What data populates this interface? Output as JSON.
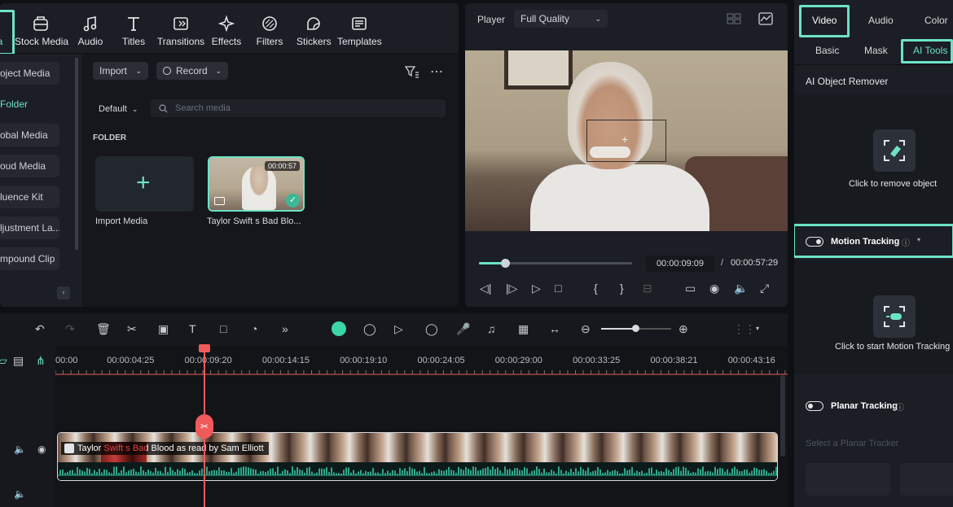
{
  "toolbar": {
    "tabs": [
      {
        "label": "a",
        "icon": "media-icon"
      },
      {
        "label": "Stock Media",
        "icon": "stock-media-icon"
      },
      {
        "label": "Audio",
        "icon": "music-note-icon"
      },
      {
        "label": "Titles",
        "icon": "text-t-icon"
      },
      {
        "label": "Transitions",
        "icon": "transition-icon"
      },
      {
        "label": "Effects",
        "icon": "sparkle-icon"
      },
      {
        "label": "Filters",
        "icon": "filter-icon"
      },
      {
        "label": "Stickers",
        "icon": "sticker-icon"
      },
      {
        "label": "Templates",
        "icon": "templates-icon"
      }
    ]
  },
  "sidebar": {
    "items": [
      {
        "label": "oject Media"
      },
      {
        "label": "Folder"
      },
      {
        "label": "obal Media"
      },
      {
        "label": "oud Media"
      },
      {
        "label": "luence Kit"
      },
      {
        "label": "ljustment La..."
      },
      {
        "label": "mpound Clip"
      }
    ]
  },
  "media": {
    "import_label": "Import",
    "record_label": "Record",
    "default_label": "Default",
    "search_placeholder": "Search media",
    "folder_heading": "FOLDER",
    "import_card_label": "Import Media",
    "clip_label": "Taylor Swift s  Bad Blo...",
    "clip_duration": "00:00:57"
  },
  "player": {
    "label": "Player",
    "quality": "Full Quality",
    "current_time": "00:00:09:09",
    "separator": "/",
    "total_time": "00:00:57:29",
    "progress": 0.17
  },
  "right_panel": {
    "tabs": [
      "Video",
      "Audio",
      "Color"
    ],
    "subtabs": [
      "Basic",
      "Mask",
      "AI Tools"
    ],
    "ai_object_remover_title": "AI Object Remover",
    "remove_object_label": "Click to remove object",
    "motion_tracking_label": "Motion Tracking",
    "start_motion_label": "Click to start Motion Tracking",
    "planar_tracking_label": "Planar Tracking",
    "planar_tracker_placeholder": "Select a Planar Tracker"
  },
  "timeline": {
    "ruler_labels": [
      "00:00",
      "00:00:04:25",
      "00:00:09:20",
      "00:00:14:15",
      "00:00:19:10",
      "00:00:24:05",
      "00:00:29:00",
      "00:00:33:25",
      "00:00:38:21",
      "00:00:43:16"
    ],
    "clip_title": "Taylor Swift s  Bad Blood  as read by Sam Elliott"
  },
  "colors": {
    "accent": "#6de3c6",
    "playhead": "#f05a5a",
    "panel": "#1b1e24"
  }
}
